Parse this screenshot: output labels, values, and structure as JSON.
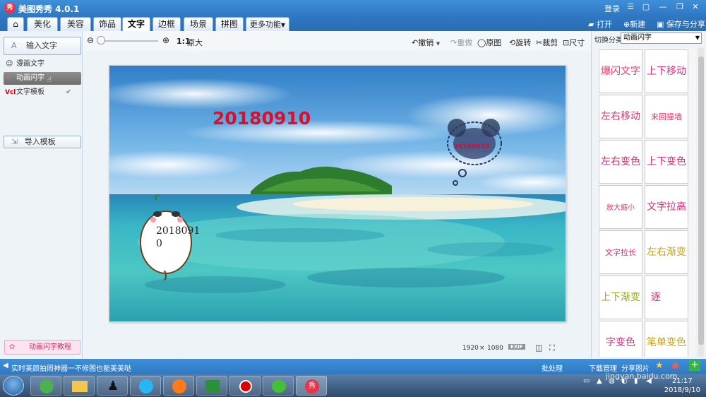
{
  "app": {
    "title": "美图秀秀 4.0.1",
    "login": "登录"
  },
  "tabs": [
    "美化",
    "美容",
    "饰品",
    "文字",
    "边框",
    "场景",
    "拼图",
    "更多功能"
  ],
  "active_tab": "文字",
  "top_actions": {
    "open": "打开",
    "new": "新建",
    "save_share": "保存与分享"
  },
  "toolbar": {
    "zoom_ratio": "1:1",
    "original_size": "原大",
    "undo": "撤销",
    "redo": "重做",
    "original_image": "原图",
    "rotate": "旋转",
    "crop": "裁剪",
    "resize": "尺寸"
  },
  "left_panel": {
    "input_text": "输入文字",
    "items": [
      "漫画文字",
      "动画闪字",
      "文字模板"
    ],
    "import_template": "导入模板",
    "tutorial": "动画闪字教程"
  },
  "canvas": {
    "main_text": "20180910",
    "cloud_text": "20180910",
    "bubble_text_line1": "2018091",
    "bubble_text_line2": "0",
    "width": "1920",
    "times": "×",
    "height": "1080",
    "exif": "EXIF"
  },
  "right_panel": {
    "category_label": "切换分类",
    "category_value": "动画闪字",
    "effects": [
      {
        "label": "爆闪文字",
        "color": "#e8386f"
      },
      {
        "label": "上下移动",
        "color": "#d0307a"
      },
      {
        "label": "左右移动",
        "color": "#d83a70"
      },
      {
        "label": "来回撞墙",
        "color": "#e0346c"
      },
      {
        "label": "左右变色",
        "color": "#d0307a"
      },
      {
        "label": "上下变色",
        "color": "#d02a78"
      },
      {
        "label": "放大缩小",
        "color": "#e0346c"
      },
      {
        "label": "文字拉高",
        "color": "#d0307a"
      },
      {
        "label": "文字拉长",
        "color": "#d0307a"
      },
      {
        "label": "左右渐变",
        "color": "#c8a020"
      },
      {
        "label": "上下渐变",
        "color": "#9aaa20"
      },
      {
        "label": "逐",
        "color": "#d0307a"
      },
      {
        "label": "字变色",
        "color": "#d0307a"
      },
      {
        "label": "笔单变色",
        "color": "#c8a020"
      }
    ]
  },
  "status_bar": {
    "message": "实时美颜拍照神器一不修图也能美美哒",
    "batch": "批处理",
    "download": "下载管理",
    "share": "分享图片"
  },
  "taskbar": {
    "time": "21:17",
    "date": "2018/9/10",
    "watermark": "jingyan.baidu.com"
  }
}
